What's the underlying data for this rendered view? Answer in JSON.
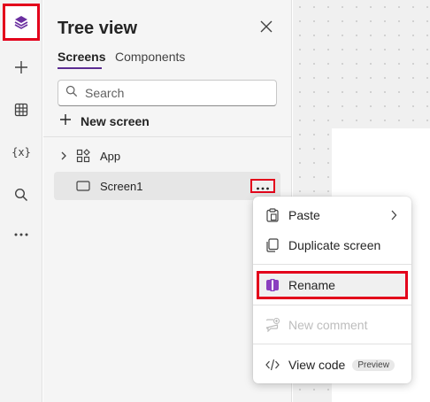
{
  "panel": {
    "title": "Tree view",
    "tabs": [
      {
        "label": "Screens",
        "active": true
      },
      {
        "label": "Components",
        "active": false
      }
    ],
    "search": {
      "placeholder": "Search",
      "value": ""
    },
    "new_screen_label": "New screen",
    "tree": [
      {
        "label": "App",
        "icon": "app-icon",
        "expandable": true
      },
      {
        "label": "Screen1",
        "icon": "screen-icon",
        "selected": true
      }
    ]
  },
  "rail": {
    "items": [
      {
        "name": "tree-view-icon",
        "active": true
      },
      {
        "name": "insert-icon"
      },
      {
        "name": "data-icon"
      },
      {
        "name": "variables-icon",
        "label": "{x}"
      },
      {
        "name": "search-icon"
      },
      {
        "name": "more-icon"
      }
    ]
  },
  "context_menu": {
    "items": [
      {
        "label": "Paste",
        "icon": "paste-icon",
        "submenu": true
      },
      {
        "label": "Duplicate screen",
        "icon": "duplicate-icon"
      },
      {
        "label": "Rename",
        "icon": "rename-icon",
        "highlighted": true
      },
      {
        "label": "New comment",
        "icon": "comment-icon",
        "disabled": true
      },
      {
        "label": "View code",
        "icon": "code-icon",
        "badge": "Preview"
      }
    ]
  },
  "colors": {
    "accent": "#5c2d91",
    "highlight_border": "#e3001b"
  }
}
